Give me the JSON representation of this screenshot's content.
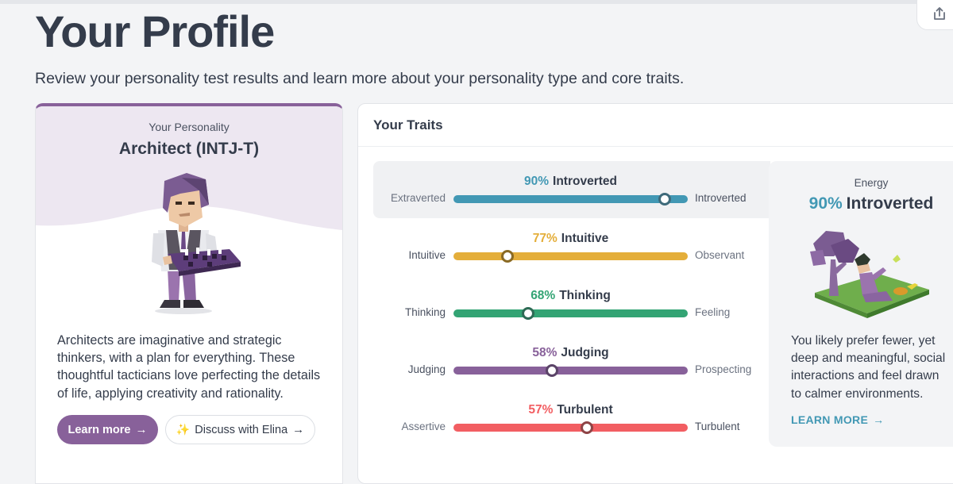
{
  "page": {
    "title": "Your Profile",
    "subtitle": "Review your personality test results and learn more about your personality type and core traits."
  },
  "colors": {
    "purple": "#88619a",
    "blue": "#4298b4",
    "yellow": "#e4ae3a",
    "green": "#33a474",
    "red": "#f25e62"
  },
  "personality": {
    "label": "Your Personality",
    "type": "Architect (INTJ-T)",
    "illustration": "architect-with-chessboard",
    "description": "Architects are imaginative and strategic thinkers, with a plan for everything. These thoughtful tacticians love perfecting the details of life, applying creativity and rationality.",
    "learn_more_label": "Learn more",
    "discuss_icon": "sparkles-icon",
    "discuss_label": "Discuss with Elina"
  },
  "traits": {
    "title": "Your Traits",
    "items": [
      {
        "pct": "90%",
        "trait": "Introverted",
        "left": "Extraverted",
        "right": "Introverted",
        "fill": 0.9,
        "color": "#4298b4",
        "knob": "#3e6a7a",
        "selected_side": "right"
      },
      {
        "pct": "77%",
        "trait": "Intuitive",
        "left": "Intuitive",
        "right": "Observant",
        "fill": 0.77,
        "color": "#e4ae3a",
        "knob": "#8a6a24",
        "selected_side": "left"
      },
      {
        "pct": "68%",
        "trait": "Thinking",
        "left": "Thinking",
        "right": "Feeling",
        "fill": 0.68,
        "color": "#33a474",
        "knob": "#2d6b55",
        "selected_side": "left"
      },
      {
        "pct": "58%",
        "trait": "Judging",
        "left": "Judging",
        "right": "Prospecting",
        "fill": 0.58,
        "color": "#88619a",
        "knob": "#5b4468",
        "selected_side": "left"
      },
      {
        "pct": "57%",
        "trait": "Turbulent",
        "left": "Assertive",
        "right": "Turbulent",
        "fill": 0.57,
        "color": "#f25e62",
        "knob": "#8e4446",
        "selected_side": "right"
      }
    ]
  },
  "energy": {
    "label": "Energy",
    "pct": "90%",
    "trait": "Introverted",
    "illustration": "person-sitting-under-tree",
    "description": "You likely prefer fewer, yet deep and meaningful, social interactions and feel drawn to calmer environments.",
    "link_label": "LEARN MORE"
  }
}
